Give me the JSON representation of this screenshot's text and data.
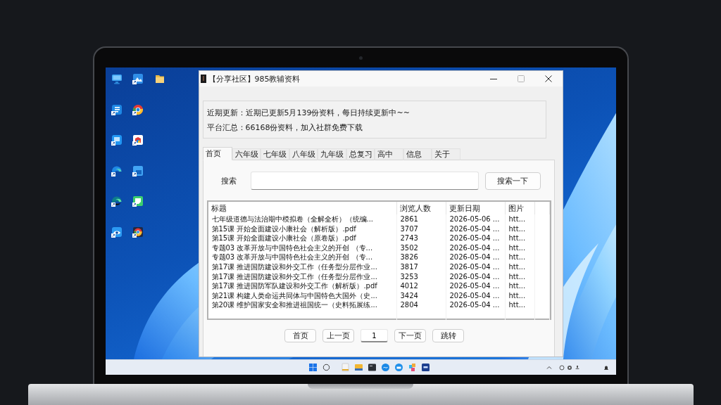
{
  "window": {
    "title": "【分享社区】985教辅资料"
  },
  "notice": {
    "lines": [
      "近期更新：近期已更新5月139份资料，每日持续更新中~~",
      "平台汇总：66168份资料，加入社群免费下载"
    ]
  },
  "tabs": [
    {
      "label": "首页",
      "selected": true
    },
    {
      "label": "六年级",
      "selected": false
    },
    {
      "label": "七年级",
      "selected": false
    },
    {
      "label": "八年级",
      "selected": false
    },
    {
      "label": "九年级",
      "selected": false
    },
    {
      "label": "总复习",
      "selected": false
    },
    {
      "label": "高中",
      "selected": false
    },
    {
      "label": "信息",
      "selected": false
    },
    {
      "label": "关于",
      "selected": false
    }
  ],
  "search": {
    "label": "搜索",
    "button": "搜索一下"
  },
  "table": {
    "columns": [
      "标题",
      "浏览人数",
      "更新日期",
      "图片"
    ],
    "rows": [
      [
        "七年级道德与法治期中模拟卷（全解全析）（统编...",
        "2861",
        "2026-05-06 ...",
        "htt..."
      ],
      [
        "第15课 开始全面建设小康社会（解析版）.pdf",
        "3707",
        "2026-05-04 ...",
        "htt..."
      ],
      [
        "第15课 开始全面建设小康社会（原卷版）.pdf",
        "2743",
        "2026-05-04 ...",
        "htt..."
      ],
      [
        "专题03 改革开放与中国特色社会主义的开创 （专...",
        "3502",
        "2026-05-04 ...",
        "htt..."
      ],
      [
        "专题03 改革开放与中国特色社会主义的开创 （专...",
        "3826",
        "2026-05-04 ...",
        "htt..."
      ],
      [
        "第17课 推进国防建设和外交工作（任务型分层作业...",
        "3817",
        "2026-05-04 ...",
        "htt..."
      ],
      [
        "第17课 推进国防建设和外交工作（任务型分层作业...",
        "3253",
        "2026-05-04 ...",
        "htt..."
      ],
      [
        "第17课 推进国防军队建设和外交工作（解析版）.pdf",
        "4012",
        "2026-05-04 ...",
        "htt..."
      ],
      [
        "第21课 构建人类命运共同体与中国特色大国外（史...",
        "3424",
        "2026-05-04 ...",
        "htt..."
      ],
      [
        "第20课 维护国家安全和推进祖国统一（史料拓展练...",
        "2804",
        "2026-05-04 ...",
        "htt..."
      ]
    ]
  },
  "pagination": {
    "items": [
      {
        "kind": "button",
        "label": "首页"
      },
      {
        "kind": "button",
        "label": "上一页"
      },
      {
        "kind": "field",
        "value": "1"
      },
      {
        "kind": "button",
        "label": "下一页"
      },
      {
        "kind": "button",
        "label": "跳转"
      }
    ]
  }
}
